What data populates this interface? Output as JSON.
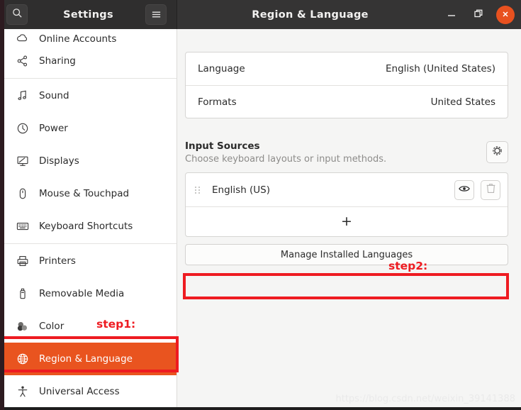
{
  "window": {
    "sidebar_title": "Settings",
    "content_title": "Region & Language",
    "search_icon": "search-icon",
    "menu_icon": "hamburger-menu-icon",
    "minimize_icon": "minimize-icon",
    "maximize_icon": "restore-window-icon",
    "close_icon": "close-icon",
    "close_color": "#e8511f"
  },
  "sidebar": {
    "selected_color": "#e9541f",
    "items": [
      {
        "label": "Online Accounts",
        "icon": "cloud-icon",
        "clipped": true,
        "selected": false
      },
      {
        "label": "Sharing",
        "icon": "share-icon",
        "clipped": false,
        "selected": false,
        "separator_after": true
      },
      {
        "label": "Sound",
        "icon": "sound-icon",
        "clipped": false,
        "selected": false
      },
      {
        "label": "Power",
        "icon": "power-icon",
        "clipped": false,
        "selected": false
      },
      {
        "label": "Displays",
        "icon": "display-icon",
        "clipped": false,
        "selected": false
      },
      {
        "label": "Mouse & Touchpad",
        "icon": "mouse-icon",
        "clipped": false,
        "selected": false
      },
      {
        "label": "Keyboard Shortcuts",
        "icon": "keyboard-icon",
        "clipped": false,
        "selected": false,
        "separator_after": true
      },
      {
        "label": "Printers",
        "icon": "printer-icon",
        "clipped": false,
        "selected": false
      },
      {
        "label": "Removable Media",
        "icon": "usb-drive-icon",
        "clipped": false,
        "selected": false
      },
      {
        "label": "Color",
        "icon": "color-icon",
        "clipped": false,
        "selected": false
      },
      {
        "label": "Region & Language",
        "icon": "globe-icon",
        "clipped": false,
        "selected": true
      },
      {
        "label": "Universal Access",
        "icon": "accessibility-icon",
        "clipped": false,
        "selected": false
      }
    ]
  },
  "main": {
    "general_rows": [
      {
        "label": "Language",
        "value": "English (United States)"
      },
      {
        "label": "Formats",
        "value": "United States"
      }
    ],
    "input_sources": {
      "title": "Input Sources",
      "subtitle": "Choose keyboard layouts or input methods.",
      "options_icon": "gear-icon",
      "sources": [
        {
          "name": "English (US)",
          "drag_icon": "drag-handle-icon",
          "preview_icon": "eye-icon",
          "remove_icon": "trash-icon"
        }
      ],
      "add_label": "+"
    },
    "manage_button": "Manage Installed Languages"
  },
  "annotations": {
    "color": "#ee1b21",
    "step1": "step1:",
    "step2": "step2:"
  },
  "watermark": "https://blog.csdn.net/weixin_39141388"
}
